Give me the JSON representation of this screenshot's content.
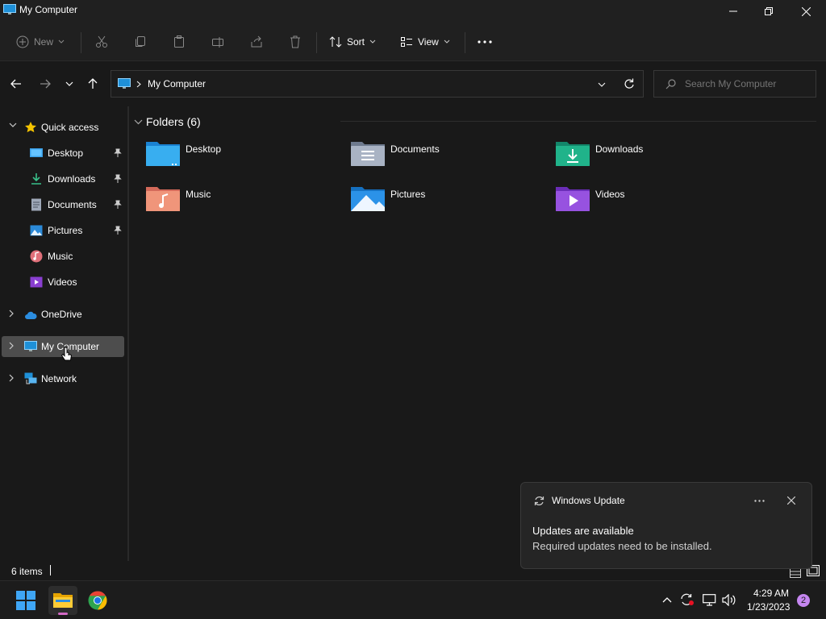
{
  "window": {
    "title": "My Computer",
    "app_icon": "computer-icon"
  },
  "title_controls": {
    "minimize": "minimize-icon",
    "maximize": "restore-icon",
    "close": "close-icon"
  },
  "toolbar": {
    "new_label": "New",
    "sort_label": "Sort",
    "view_label": "View",
    "icons": [
      "new-icon",
      "cut-icon",
      "copy-icon",
      "paste-icon",
      "rename-icon",
      "share-icon",
      "delete-icon",
      "sort-icon",
      "view-icon",
      "more-icon"
    ]
  },
  "address": {
    "path": "My Computer",
    "search_placeholder": "Search My Computer"
  },
  "sidebar": {
    "items": [
      {
        "label": "Quick access",
        "icon": "star-icon"
      },
      {
        "label": "Desktop",
        "icon": "desktop-icon",
        "pinned": true
      },
      {
        "label": "Downloads",
        "icon": "download-icon",
        "pinned": true
      },
      {
        "label": "Documents",
        "icon": "documents-icon",
        "pinned": true
      },
      {
        "label": "Pictures",
        "icon": "pictures-icon",
        "pinned": true
      },
      {
        "label": "Music",
        "icon": "music-icon"
      },
      {
        "label": "Videos",
        "icon": "videos-icon"
      },
      {
        "label": "OneDrive",
        "icon": "onedrive-icon"
      },
      {
        "label": "My Computer",
        "icon": "computer-icon",
        "selected": true
      },
      {
        "label": "Network",
        "icon": "network-icon"
      }
    ]
  },
  "main": {
    "group_label": "Folders (6)",
    "folders": [
      {
        "name": "Desktop",
        "icon": "desktop-folder-icon"
      },
      {
        "name": "Documents",
        "icon": "documents-folder-icon"
      },
      {
        "name": "Downloads",
        "icon": "downloads-folder-icon"
      },
      {
        "name": "Music",
        "icon": "music-folder-icon"
      },
      {
        "name": "Pictures",
        "icon": "pictures-folder-icon"
      },
      {
        "name": "Videos",
        "icon": "videos-folder-icon"
      }
    ]
  },
  "status": {
    "item_count": "6 items"
  },
  "toast": {
    "app": "Windows Update",
    "heading": "Updates are available",
    "body": "Required updates need to be installed."
  },
  "taskbar": {
    "time": "4:29 AM",
    "date": "1/23/2023",
    "notification_count": "2",
    "apps": [
      "windows-start-icon",
      "file-explorer-icon",
      "chrome-icon"
    ],
    "tray": [
      "chevron-up-icon",
      "update-icon",
      "network-icon",
      "volume-icon"
    ]
  },
  "colors": {
    "accent": "#60cdff",
    "selected_bg": "#4d4d4d",
    "window_bg": "#191919",
    "toolbar_bg": "#202020",
    "badge": "#c586f0"
  }
}
